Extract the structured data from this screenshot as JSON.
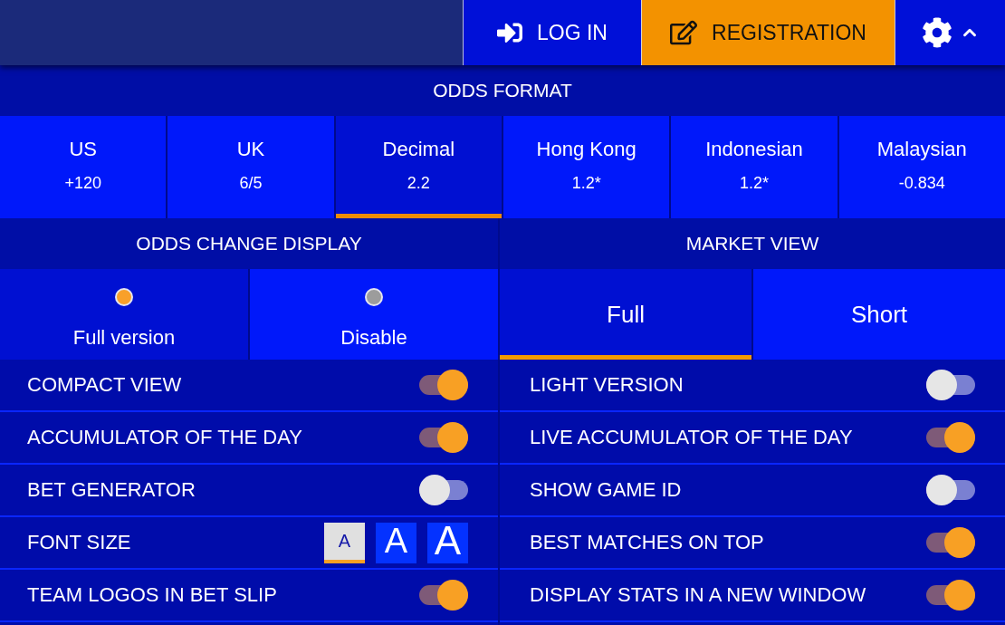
{
  "header": {
    "login": {
      "label": "LOG IN"
    },
    "registration": {
      "label": "REGISTRATION"
    },
    "settings": {
      "expanded": true
    }
  },
  "odds_format": {
    "title": "ODDS FORMAT",
    "options": [
      {
        "label": "US",
        "example": "+120",
        "selected": false
      },
      {
        "label": "UK",
        "example": "6/5",
        "selected": false
      },
      {
        "label": "Decimal",
        "example": "2.2",
        "selected": true
      },
      {
        "label": "Hong Kong",
        "example": "1.2*",
        "selected": false
      },
      {
        "label": "Indonesian",
        "example": "1.2*",
        "selected": false
      },
      {
        "label": "Malaysian",
        "example": "-0.834",
        "selected": false
      }
    ]
  },
  "odds_change_display": {
    "title": "ODDS CHANGE DISPLAY",
    "options": [
      {
        "label": "Full version",
        "selected": true
      },
      {
        "label": "Disable",
        "selected": false
      }
    ]
  },
  "market_view": {
    "title": "MARKET VIEW",
    "options": [
      {
        "label": "Full",
        "selected": true
      },
      {
        "label": "Short",
        "selected": false
      }
    ]
  },
  "settings_left": [
    {
      "kind": "toggle",
      "label": "COMPACT VIEW",
      "on": true
    },
    {
      "kind": "toggle",
      "label": "ACCUMULATOR OF THE DAY",
      "on": true
    },
    {
      "kind": "toggle",
      "label": "BET GENERATOR",
      "on": false
    },
    {
      "kind": "font_size",
      "label": "FONT SIZE",
      "sizes": [
        {
          "label": "A",
          "selected": true
        },
        {
          "label": "A",
          "selected": false
        },
        {
          "label": "A",
          "selected": false
        }
      ]
    },
    {
      "kind": "toggle",
      "label": "TEAM LOGOS IN BET SLIP",
      "on": true
    }
  ],
  "settings_right": [
    {
      "kind": "toggle",
      "label": "LIGHT VERSION",
      "on": false
    },
    {
      "kind": "toggle",
      "label": "LIVE ACCUMULATOR OF THE DAY",
      "on": true
    },
    {
      "kind": "toggle",
      "label": "SHOW GAME ID",
      "on": false
    },
    {
      "kind": "toggle",
      "label": "BEST MATCHES ON TOP",
      "on": true
    },
    {
      "kind": "toggle",
      "label": "DISPLAY STATS IN A NEW WINDOW",
      "on": true
    }
  ]
}
